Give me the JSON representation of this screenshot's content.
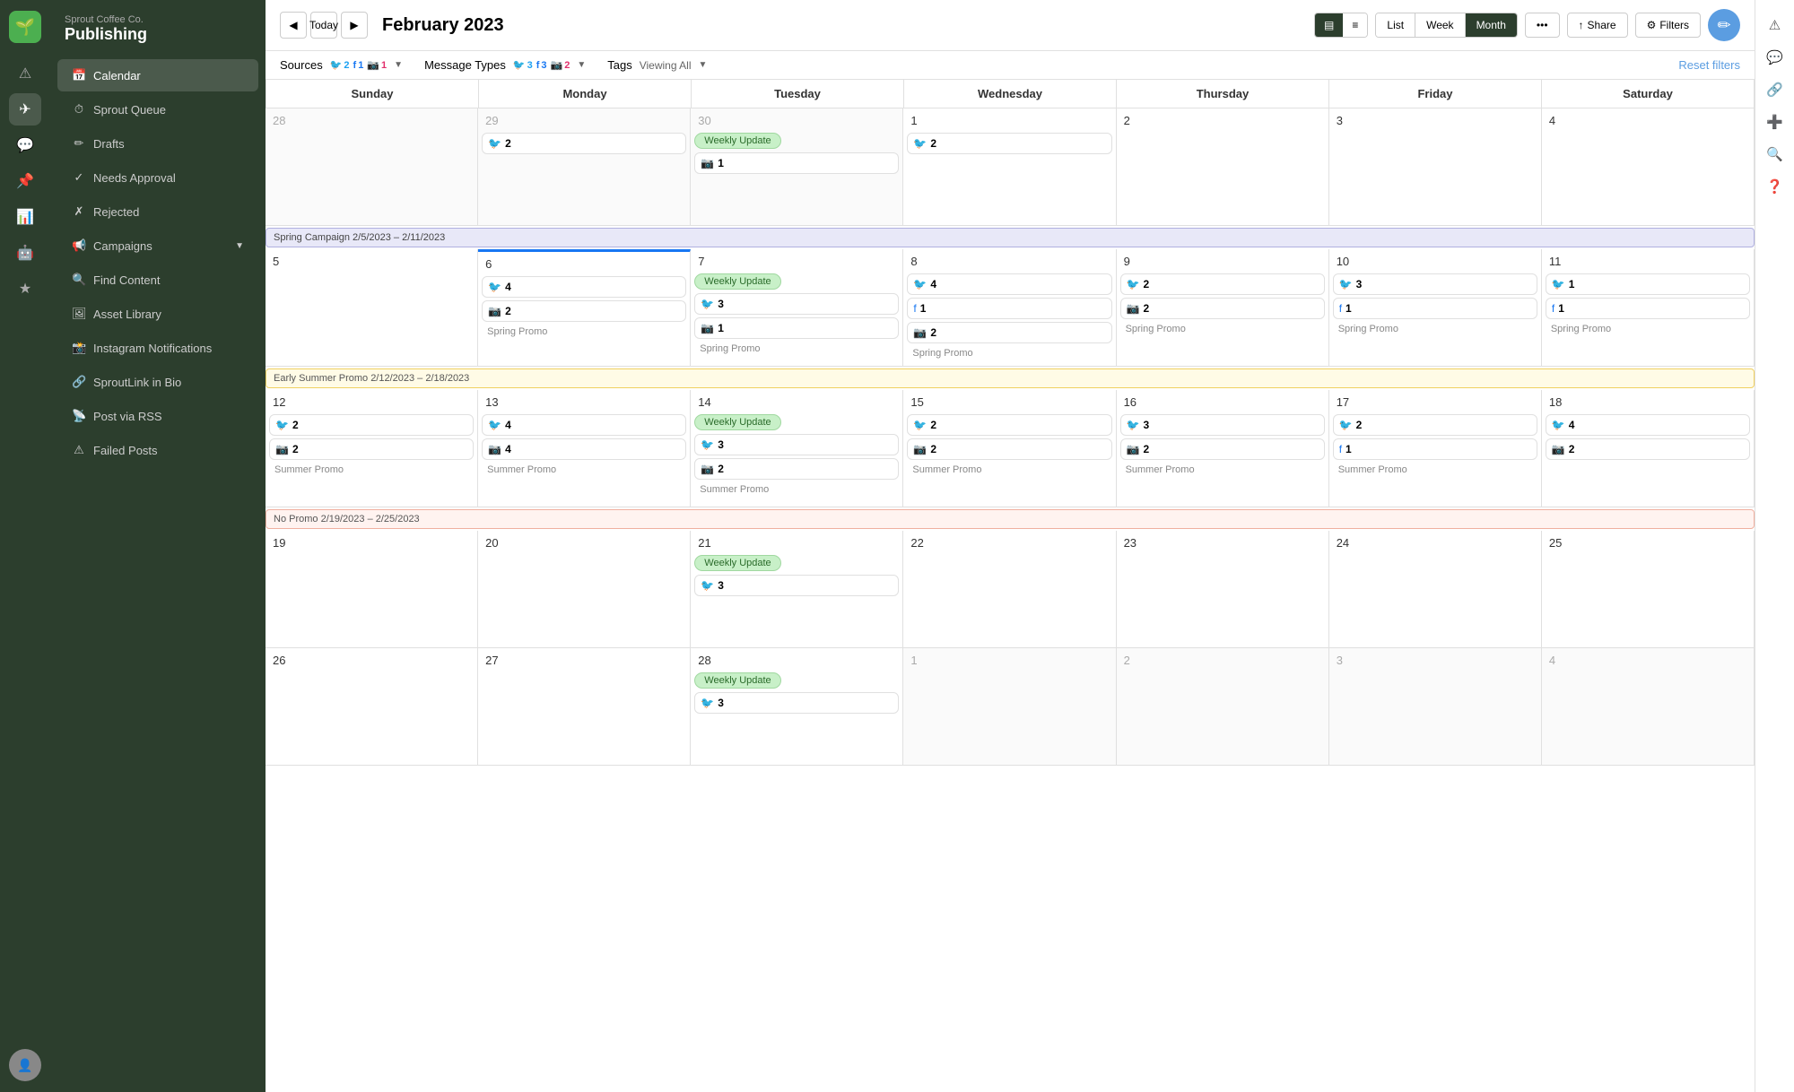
{
  "app": {
    "company": "Sprout Coffee Co.",
    "appName": "Publishing"
  },
  "toolbar": {
    "todayLabel": "Today",
    "monthTitle": "February 2023",
    "viewToggle": [
      "▤",
      "≡"
    ],
    "viewModes": [
      "List",
      "Week",
      "Month"
    ],
    "activeViewMode": "Month",
    "moreLabel": "•••",
    "shareLabel": "Share",
    "filtersLabel": "Filters"
  },
  "filters": {
    "sourcesLabel": "Sources",
    "sourcesTwitter": "2",
    "sourcesFacebook": "1",
    "sourcesInstagram": "1",
    "messageTypesLabel": "Message Types",
    "messageTypesTwitter": "3",
    "messageTypesFacebook": "3",
    "messageTypesInstagram": "2",
    "tagsLabel": "Tags",
    "tagsValue": "Viewing All",
    "resetLabel": "Reset filters"
  },
  "nav": {
    "items": [
      {
        "id": "calendar",
        "label": "Calendar",
        "active": true
      },
      {
        "id": "sprout-queue",
        "label": "Sprout Queue",
        "active": false
      },
      {
        "id": "drafts",
        "label": "Drafts",
        "active": false
      },
      {
        "id": "needs-approval",
        "label": "Needs Approval",
        "active": false
      },
      {
        "id": "rejected",
        "label": "Rejected",
        "active": false
      },
      {
        "id": "campaigns",
        "label": "Campaigns",
        "active": false
      },
      {
        "id": "find-content",
        "label": "Find Content",
        "active": false
      },
      {
        "id": "asset-library",
        "label": "Asset Library",
        "active": false
      },
      {
        "id": "instagram-notifications",
        "label": "Instagram Notifications",
        "active": false
      },
      {
        "id": "sproutlink",
        "label": "SproutLink in Bio",
        "active": false
      },
      {
        "id": "post-via-rss",
        "label": "Post via RSS",
        "active": false
      },
      {
        "id": "failed-posts",
        "label": "Failed Posts",
        "active": false
      }
    ]
  },
  "calendar": {
    "dayHeaders": [
      "Sunday",
      "Monday",
      "Tuesday",
      "Wednesday",
      "Thursday",
      "Friday",
      "Saturday"
    ],
    "weeks": [
      {
        "days": [
          {
            "num": "28",
            "inactive": true,
            "posts": []
          },
          {
            "num": "29",
            "inactive": true,
            "posts": [
              {
                "type": "twitter",
                "count": 2
              }
            ]
          },
          {
            "num": "30",
            "inactive": true,
            "weeklyUpdate": true,
            "posts": [
              {
                "type": "instagram",
                "count": 1
              }
            ]
          },
          {
            "num": "1",
            "posts": [
              {
                "type": "twitter",
                "count": 2
              }
            ]
          },
          {
            "num": "2",
            "posts": []
          },
          {
            "num": "3",
            "posts": []
          },
          {
            "num": "4",
            "posts": []
          }
        ]
      },
      {
        "campaign": {
          "label": "Spring Campaign 2/5/2023 – 2/11/2023",
          "type": "spring"
        },
        "days": [
          {
            "num": "5",
            "posts": []
          },
          {
            "num": "6",
            "today": true,
            "posts": [
              {
                "type": "twitter",
                "count": 4
              },
              {
                "type": "instagram",
                "count": 2,
                "promo": "Spring Promo"
              }
            ]
          },
          {
            "num": "7",
            "weeklyUpdate": true,
            "posts": [
              {
                "type": "twitter",
                "count": 3
              },
              {
                "type": "instagram",
                "count": 1,
                "promo": "Spring Promo"
              }
            ]
          },
          {
            "num": "8",
            "posts": [
              {
                "type": "twitter",
                "count": 4
              },
              {
                "type": "facebook",
                "count": 1
              },
              {
                "type": "instagram",
                "count": 2,
                "promo": "Spring Promo"
              }
            ]
          },
          {
            "num": "9",
            "posts": [
              {
                "type": "twitter",
                "count": 2
              },
              {
                "type": "instagram",
                "count": 2,
                "promo": "Spring Promo"
              }
            ]
          },
          {
            "num": "10",
            "posts": [
              {
                "type": "twitter",
                "count": 3
              },
              {
                "type": "facebook",
                "count": 1,
                "promo": "Spring Promo"
              }
            ]
          },
          {
            "num": "11",
            "posts": [
              {
                "type": "twitter",
                "count": 1
              },
              {
                "type": "facebook",
                "count": 1,
                "promo": "Spring Promo"
              }
            ]
          }
        ]
      },
      {
        "campaign": {
          "label": "Early Summer Promo 2/12/2023 – 2/18/2023",
          "type": "summer"
        },
        "days": [
          {
            "num": "12",
            "posts": [
              {
                "type": "twitter",
                "count": 2
              },
              {
                "type": "instagram",
                "count": 2,
                "promo": "Summer Promo"
              }
            ]
          },
          {
            "num": "13",
            "posts": [
              {
                "type": "twitter",
                "count": 4
              },
              {
                "type": "instagram",
                "count": 4,
                "promo": "Summer Promo"
              }
            ]
          },
          {
            "num": "14",
            "weeklyUpdate": true,
            "posts": [
              {
                "type": "twitter",
                "count": 3
              },
              {
                "type": "instagram",
                "count": 2,
                "promo": "Summer Promo"
              }
            ]
          },
          {
            "num": "15",
            "posts": [
              {
                "type": "twitter",
                "count": 2
              },
              {
                "type": "instagram",
                "count": 2,
                "promo": "Summer Promo"
              }
            ]
          },
          {
            "num": "16",
            "posts": [
              {
                "type": "twitter",
                "count": 3
              },
              {
                "type": "instagram",
                "count": 2,
                "promo": "Summer Promo"
              }
            ]
          },
          {
            "num": "17",
            "posts": [
              {
                "type": "twitter",
                "count": 2
              },
              {
                "type": "facebook",
                "count": 1,
                "promo": "Summer Promo"
              }
            ]
          },
          {
            "num": "18",
            "posts": [
              {
                "type": "twitter",
                "count": 4
              },
              {
                "type": "instagram",
                "count": 2
              }
            ]
          }
        ]
      },
      {
        "campaign": {
          "label": "No Promo 2/19/2023 – 2/25/2023",
          "type": "no-promo"
        },
        "days": [
          {
            "num": "19",
            "posts": []
          },
          {
            "num": "20",
            "posts": []
          },
          {
            "num": "21",
            "weeklyUpdate": true,
            "posts": [
              {
                "type": "twitter",
                "count": 3
              }
            ]
          },
          {
            "num": "22",
            "posts": []
          },
          {
            "num": "23",
            "posts": []
          },
          {
            "num": "24",
            "posts": []
          },
          {
            "num": "25",
            "posts": []
          }
        ]
      },
      {
        "days": [
          {
            "num": "26",
            "posts": []
          },
          {
            "num": "27",
            "posts": []
          },
          {
            "num": "28",
            "weeklyUpdate": true,
            "posts": [
              {
                "type": "twitter",
                "count": 3
              }
            ]
          },
          {
            "num": "1",
            "inactive": true,
            "posts": []
          },
          {
            "num": "2",
            "inactive": true,
            "posts": []
          },
          {
            "num": "3",
            "inactive": true,
            "posts": []
          },
          {
            "num": "4",
            "inactive": true,
            "posts": []
          }
        ]
      }
    ],
    "weeklyUpdateLabel": "Weekly Update"
  },
  "rightSidebar": {
    "icons": [
      "⚠",
      "💬",
      "🔗",
      "➕",
      "🔍",
      "❓"
    ]
  }
}
